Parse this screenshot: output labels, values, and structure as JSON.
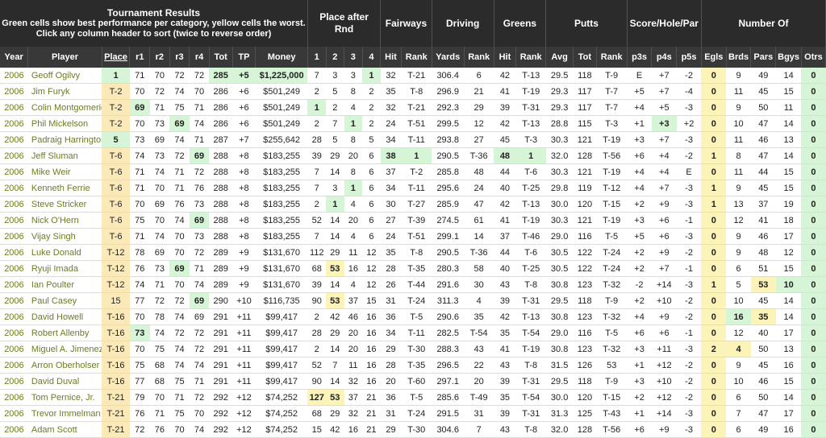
{
  "header": {
    "title": "Tournament Results",
    "subtitle1": "Green cells show best performance per category, yellow cells the worst.",
    "subtitle2": "Click any column header to sort (twice to reverse order)",
    "groups": {
      "place_after_rnd": "Place after Rnd",
      "fairways": "Fairways",
      "driving": "Driving",
      "greens": "Greens",
      "putts": "Putts",
      "score_hole_par": "Score/Hole/Par",
      "number_of": "Number Of"
    }
  },
  "columns": [
    "Year",
    "Player",
    "Place",
    "r1",
    "r2",
    "r3",
    "r4",
    "Tot",
    "TP",
    "Money",
    "1",
    "2",
    "3",
    "4",
    "Hit",
    "Rank",
    "Yards",
    "Rank",
    "Hit",
    "Rank",
    "Avg",
    "Tot",
    "Rank",
    "p3s",
    "p4s",
    "p5s",
    "Egls",
    "Brds",
    "Pars",
    "Bgys",
    "Otrs"
  ],
  "rows": [
    [
      "2006",
      "Geoff Ogilvy",
      "1",
      "71",
      "70",
      "72",
      "72",
      "285",
      "+5",
      "$1,225,000",
      "7",
      "3",
      "3",
      "1",
      "32",
      "T-21",
      "306.4",
      "6",
      "42",
      "T-13",
      "29.5",
      "118",
      "T-9",
      "E",
      "+7",
      "-2",
      "0",
      "9",
      "49",
      "14",
      "0"
    ],
    [
      "2006",
      "Jim Furyk",
      "T-2",
      "70",
      "72",
      "74",
      "70",
      "286",
      "+6",
      "$501,249",
      "2",
      "5",
      "8",
      "2",
      "35",
      "T-8",
      "296.9",
      "21",
      "41",
      "T-19",
      "29.3",
      "117",
      "T-7",
      "+5",
      "+7",
      "-4",
      "0",
      "11",
      "45",
      "15",
      "0"
    ],
    [
      "2006",
      "Colin Montgomerie",
      "T-2",
      "69",
      "71",
      "75",
      "71",
      "286",
      "+6",
      "$501,249",
      "1",
      "2",
      "4",
      "2",
      "32",
      "T-21",
      "292.3",
      "29",
      "39",
      "T-31",
      "29.3",
      "117",
      "T-7",
      "+4",
      "+5",
      "-3",
      "0",
      "9",
      "50",
      "11",
      "0"
    ],
    [
      "2006",
      "Phil Mickelson",
      "T-2",
      "70",
      "73",
      "69",
      "74",
      "286",
      "+6",
      "$501,249",
      "2",
      "7",
      "1",
      "2",
      "24",
      "T-51",
      "299.5",
      "12",
      "42",
      "T-13",
      "28.8",
      "115",
      "T-3",
      "+1",
      "+3",
      "+2",
      "0",
      "10",
      "47",
      "14",
      "0"
    ],
    [
      "2006",
      "Padraig Harrington",
      "5",
      "73",
      "69",
      "74",
      "71",
      "287",
      "+7",
      "$255,642",
      "28",
      "5",
      "8",
      "5",
      "34",
      "T-11",
      "293.8",
      "27",
      "45",
      "T-3",
      "30.3",
      "121",
      "T-19",
      "+3",
      "+7",
      "-3",
      "0",
      "11",
      "46",
      "13",
      "0"
    ],
    [
      "2006",
      "Jeff Sluman",
      "T-6",
      "74",
      "73",
      "72",
      "69",
      "288",
      "+8",
      "$183,255",
      "39",
      "29",
      "20",
      "6",
      "38",
      "1",
      "290.5",
      "T-36",
      "48",
      "1",
      "32.0",
      "128",
      "T-56",
      "+6",
      "+4",
      "-2",
      "1",
      "8",
      "47",
      "14",
      "0"
    ],
    [
      "2006",
      "Mike Weir",
      "T-6",
      "71",
      "74",
      "71",
      "72",
      "288",
      "+8",
      "$183,255",
      "7",
      "14",
      "8",
      "6",
      "37",
      "T-2",
      "285.8",
      "48",
      "44",
      "T-6",
      "30.3",
      "121",
      "T-19",
      "+4",
      "+4",
      "E",
      "0",
      "11",
      "44",
      "15",
      "0"
    ],
    [
      "2006",
      "Kenneth Ferrie",
      "T-6",
      "71",
      "70",
      "71",
      "76",
      "288",
      "+8",
      "$183,255",
      "7",
      "3",
      "1",
      "6",
      "34",
      "T-11",
      "295.6",
      "24",
      "40",
      "T-25",
      "29.8",
      "119",
      "T-12",
      "+4",
      "+7",
      "-3",
      "1",
      "9",
      "45",
      "15",
      "0"
    ],
    [
      "2006",
      "Steve Stricker",
      "T-6",
      "70",
      "69",
      "76",
      "73",
      "288",
      "+8",
      "$183,255",
      "2",
      "1",
      "4",
      "6",
      "30",
      "T-27",
      "285.9",
      "47",
      "42",
      "T-13",
      "30.0",
      "120",
      "T-15",
      "+2",
      "+9",
      "-3",
      "1",
      "13",
      "37",
      "19",
      "0"
    ],
    [
      "2006",
      "Nick O'Hern",
      "T-6",
      "75",
      "70",
      "74",
      "69",
      "288",
      "+8",
      "$183,255",
      "52",
      "14",
      "20",
      "6",
      "27",
      "T-39",
      "274.5",
      "61",
      "41",
      "T-19",
      "30.3",
      "121",
      "T-19",
      "+3",
      "+6",
      "-1",
      "0",
      "12",
      "41",
      "18",
      "0"
    ],
    [
      "2006",
      "Vijay Singh",
      "T-6",
      "71",
      "74",
      "70",
      "73",
      "288",
      "+8",
      "$183,255",
      "7",
      "14",
      "4",
      "6",
      "24",
      "T-51",
      "299.1",
      "14",
      "37",
      "T-46",
      "29.0",
      "116",
      "T-5",
      "+5",
      "+6",
      "-3",
      "0",
      "9",
      "46",
      "17",
      "0"
    ],
    [
      "2006",
      "Luke Donald",
      "T-12",
      "78",
      "69",
      "70",
      "72",
      "289",
      "+9",
      "$131,670",
      "112",
      "29",
      "11",
      "12",
      "35",
      "T-8",
      "290.5",
      "T-36",
      "44",
      "T-6",
      "30.5",
      "122",
      "T-24",
      "+2",
      "+9",
      "-2",
      "0",
      "9",
      "48",
      "12",
      "0"
    ],
    [
      "2006",
      "Ryuji Imada",
      "T-12",
      "76",
      "73",
      "69",
      "71",
      "289",
      "+9",
      "$131,670",
      "68",
      "53",
      "16",
      "12",
      "28",
      "T-35",
      "280.3",
      "58",
      "40",
      "T-25",
      "30.5",
      "122",
      "T-24",
      "+2",
      "+7",
      "-1",
      "0",
      "6",
      "51",
      "15",
      "0"
    ],
    [
      "2006",
      "Ian Poulter",
      "T-12",
      "74",
      "71",
      "70",
      "74",
      "289",
      "+9",
      "$131,670",
      "39",
      "14",
      "4",
      "12",
      "26",
      "T-44",
      "291.6",
      "30",
      "43",
      "T-8",
      "30.8",
      "123",
      "T-32",
      "-2",
      "+14",
      "-3",
      "1",
      "5",
      "53",
      "10",
      "0"
    ],
    [
      "2006",
      "Paul Casey",
      "15",
      "77",
      "72",
      "72",
      "69",
      "290",
      "+10",
      "$116,735",
      "90",
      "53",
      "37",
      "15",
      "31",
      "T-24",
      "311.3",
      "4",
      "39",
      "T-31",
      "29.5",
      "118",
      "T-9",
      "+2",
      "+10",
      "-2",
      "0",
      "10",
      "45",
      "14",
      "0"
    ],
    [
      "2006",
      "David Howell",
      "T-16",
      "70",
      "78",
      "74",
      "69",
      "291",
      "+11",
      "$99,417",
      "2",
      "42",
      "46",
      "16",
      "36",
      "T-5",
      "290.6",
      "35",
      "42",
      "T-13",
      "30.8",
      "123",
      "T-32",
      "+4",
      "+9",
      "-2",
      "0",
      "16",
      "35",
      "14",
      "0"
    ],
    [
      "2006",
      "Robert Allenby",
      "T-16",
      "73",
      "74",
      "72",
      "72",
      "291",
      "+11",
      "$99,417",
      "28",
      "29",
      "20",
      "16",
      "34",
      "T-11",
      "282.5",
      "T-54",
      "35",
      "T-54",
      "29.0",
      "116",
      "T-5",
      "+6",
      "+6",
      "-1",
      "0",
      "12",
      "40",
      "17",
      "0"
    ],
    [
      "2006",
      "Miguel A. Jimenez",
      "T-16",
      "70",
      "75",
      "74",
      "72",
      "291",
      "+11",
      "$99,417",
      "2",
      "14",
      "20",
      "16",
      "29",
      "T-30",
      "288.3",
      "43",
      "41",
      "T-19",
      "30.8",
      "123",
      "T-32",
      "+3",
      "+11",
      "-3",
      "2",
      "4",
      "50",
      "13",
      "0"
    ],
    [
      "2006",
      "Arron Oberholser",
      "T-16",
      "75",
      "68",
      "74",
      "74",
      "291",
      "+11",
      "$99,417",
      "52",
      "7",
      "11",
      "16",
      "28",
      "T-35",
      "296.5",
      "22",
      "43",
      "T-8",
      "31.5",
      "126",
      "53",
      "+1",
      "+12",
      "-2",
      "0",
      "9",
      "45",
      "16",
      "0"
    ],
    [
      "2006",
      "David Duval",
      "T-16",
      "77",
      "68",
      "75",
      "71",
      "291",
      "+11",
      "$99,417",
      "90",
      "14",
      "32",
      "16",
      "20",
      "T-60",
      "297.1",
      "20",
      "39",
      "T-31",
      "29.5",
      "118",
      "T-9",
      "+3",
      "+10",
      "-2",
      "0",
      "10",
      "46",
      "15",
      "0"
    ],
    [
      "2006",
      "Tom Pernice, Jr.",
      "T-21",
      "79",
      "70",
      "71",
      "72",
      "292",
      "+12",
      "$74,252",
      "127",
      "53",
      "37",
      "21",
      "36",
      "T-5",
      "285.6",
      "T-49",
      "35",
      "T-54",
      "30.0",
      "120",
      "T-15",
      "+2",
      "+12",
      "-2",
      "0",
      "6",
      "50",
      "14",
      "0"
    ],
    [
      "2006",
      "Trevor Immelman",
      "T-21",
      "76",
      "71",
      "75",
      "70",
      "292",
      "+12",
      "$74,252",
      "68",
      "29",
      "32",
      "21",
      "31",
      "T-24",
      "291.5",
      "31",
      "39",
      "T-31",
      "31.3",
      "125",
      "T-43",
      "+1",
      "+14",
      "-3",
      "0",
      "7",
      "47",
      "17",
      "0"
    ],
    [
      "2006",
      "Adam Scott",
      "T-21",
      "72",
      "76",
      "70",
      "74",
      "292",
      "+12",
      "$74,252",
      "15",
      "42",
      "16",
      "21",
      "29",
      "T-30",
      "304.6",
      "7",
      "43",
      "T-8",
      "32.0",
      "128",
      "T-56",
      "+6",
      "+9",
      "-3",
      "0",
      "6",
      "49",
      "16",
      "0"
    ]
  ],
  "highlights": {
    "green": [
      [
        0,
        2
      ],
      [
        0,
        7
      ],
      [
        0,
        8
      ],
      [
        0,
        9
      ],
      [
        0,
        13
      ],
      [
        2,
        3
      ],
      [
        2,
        10
      ],
      [
        3,
        5
      ],
      [
        3,
        12
      ],
      [
        3,
        24
      ],
      [
        4,
        2
      ],
      [
        5,
        6
      ],
      [
        5,
        14
      ],
      [
        5,
        15
      ],
      [
        5,
        18
      ],
      [
        5,
        19
      ],
      [
        7,
        12
      ],
      [
        8,
        11
      ],
      [
        9,
        6
      ],
      [
        12,
        5
      ],
      [
        13,
        29
      ],
      [
        14,
        6
      ],
      [
        15,
        27
      ],
      [
        16,
        3
      ]
    ],
    "yellow": [
      [
        12,
        11
      ],
      [
        13,
        28
      ],
      [
        14,
        11
      ],
      [
        15,
        28
      ],
      [
        17,
        26
      ],
      [
        17,
        27
      ],
      [
        20,
        10
      ],
      [
        20,
        11
      ]
    ]
  }
}
